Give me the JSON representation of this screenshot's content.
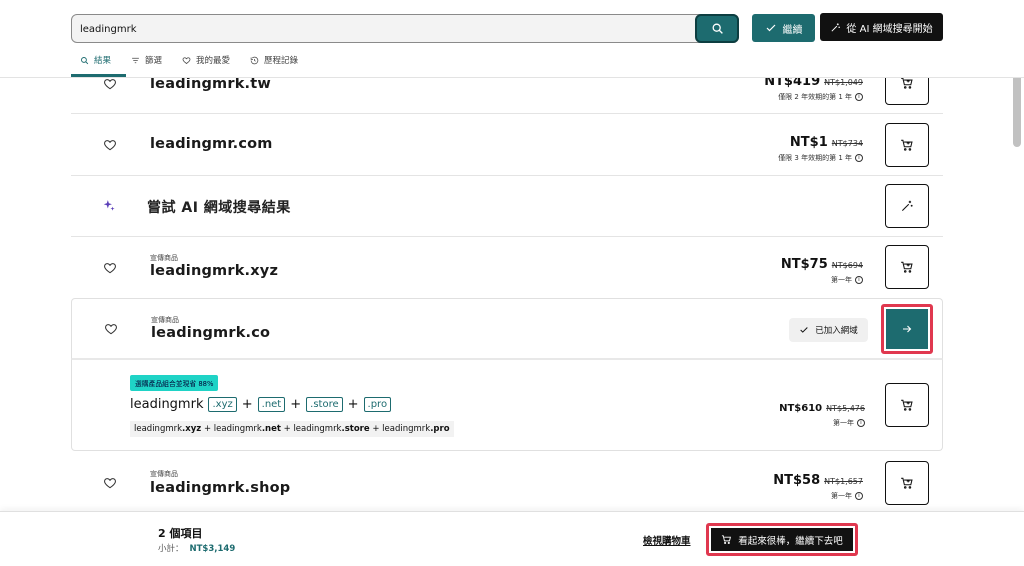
{
  "search": {
    "value": "leadingmrk"
  },
  "header": {
    "continue_label": "繼續",
    "ai_label": "從 AI 網域搜尋開始"
  },
  "tabs": [
    {
      "label": "結果",
      "active": true
    },
    {
      "label": "篩選"
    },
    {
      "label": "我的最愛"
    },
    {
      "label": "歷程記錄"
    }
  ],
  "rows": [
    {
      "domain": "leadingmrk.tw",
      "price": "NT$419",
      "was": "NT$1,049",
      "term": "僅限 2 年效期的第 1 年"
    },
    {
      "domain": "leadingmr.com",
      "price": "NT$1",
      "was": "NT$734",
      "term": "僅限 3 年效期的第 1 年"
    },
    {
      "ai_text": "嘗試 AI 網域搜尋結果"
    },
    {
      "promo": "宣傳商品",
      "domain": "leadingmrk.xyz",
      "price": "NT$75",
      "was": "NT$694",
      "term": "第一年"
    },
    {
      "promo": "宣傳商品",
      "domain": "leadingmrk.co",
      "added": "已加入網域"
    },
    {
      "promo": "宣傳商品",
      "domain": "leadingmrk.shop",
      "price": "NT$58",
      "was": "NT$1,657",
      "term": "第一年"
    }
  ],
  "bundle": {
    "tag": "選購產品組合並現省 88%",
    "base": "leadingmrk",
    "tlds": [
      ".xyz",
      ".net",
      ".store",
      ".pro"
    ],
    "plus": "+",
    "sub_parts": [
      "leadingmrk",
      ".xyz",
      " + leadingmrk",
      ".net",
      " + leadingmrk",
      ".store",
      " + leadingmrk",
      ".pro"
    ],
    "price": "NT$610",
    "was": "NT$5,476",
    "term": "第一年"
  },
  "footer": {
    "count": "2 個項目",
    "subtotal_label": "小計：",
    "subtotal_value": "NT$3,149",
    "view_cart": "檢視購物車",
    "checkout": "看起來很棒，繼續下去吧"
  },
  "colors": {
    "accent": "#1d6b6f",
    "highlight": "#e0384f",
    "tag": "#1fd3c6"
  },
  "info_glyph": "i"
}
